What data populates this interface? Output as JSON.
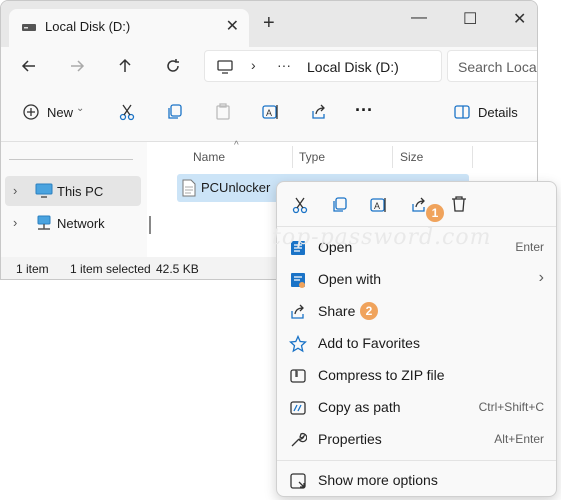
{
  "window": {
    "tab_title": "Local Disk (D:)",
    "tab_close": "✕",
    "new_tab": "+",
    "minimize": "—",
    "maximize": "☐",
    "close": "✕"
  },
  "address": {
    "ellipsis": "···",
    "path": "Local Disk (D:)",
    "search_placeholder": "Search Local"
  },
  "toolbar": {
    "new_label": "New",
    "more": "···",
    "details_label": "Details"
  },
  "nav_pane": {
    "items": [
      {
        "label": "This PC",
        "icon": "monitor-icon",
        "selected": true
      },
      {
        "label": "Network",
        "icon": "network-icon",
        "selected": false
      }
    ]
  },
  "file_list": {
    "columns": [
      "Name",
      "Type",
      "Size"
    ],
    "rows": [
      {
        "name": "PCUnlocker"
      }
    ]
  },
  "status_bar": {
    "count": "1 item",
    "selection": "1 item selected",
    "size": "42.5 KB"
  },
  "watermark": "top-password.com",
  "context_menu": {
    "top_icons": [
      "cut-icon",
      "copy-icon",
      "rename-icon",
      "share-icon",
      "delete-icon"
    ],
    "items": [
      {
        "label": "Open",
        "shortcut": "Enter",
        "icon": "open-icon"
      },
      {
        "label": "Open with",
        "shortcut": "›",
        "icon": "open-with-icon"
      },
      {
        "label": "Share",
        "shortcut": "",
        "icon": "share-icon"
      },
      {
        "label": "Add to Favorites",
        "shortcut": "",
        "icon": "star-icon"
      },
      {
        "label": "Compress to ZIP file",
        "shortcut": "",
        "icon": "zip-icon"
      },
      {
        "label": "Copy as path",
        "shortcut": "Ctrl+Shift+C",
        "icon": "copy-path-icon"
      },
      {
        "label": "Properties",
        "shortcut": "Alt+Enter",
        "icon": "wrench-icon"
      },
      {
        "label": "Show more options",
        "shortcut": "",
        "icon": "more-options-icon"
      }
    ],
    "badges": [
      "1",
      "2"
    ]
  },
  "colors": {
    "accent": "#1a73c7",
    "selection": "#cce4f7",
    "badge": "#f0a35c"
  }
}
